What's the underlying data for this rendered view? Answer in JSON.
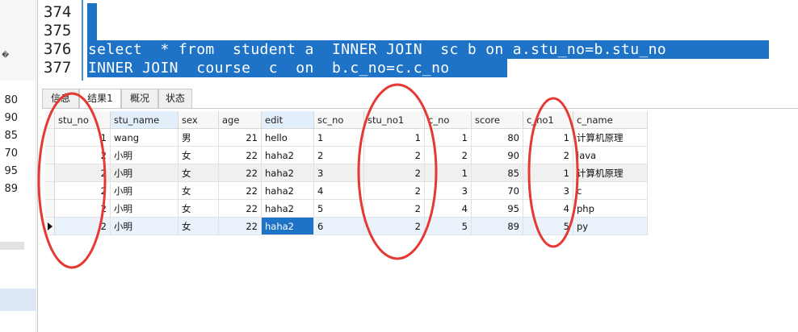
{
  "left_pane": {
    "mini_label": "�",
    "row_numbers": [
      "80",
      "90",
      "85",
      "70",
      "95",
      "89"
    ]
  },
  "editor": {
    "line_numbers": [
      "374",
      "375",
      "376",
      "377"
    ],
    "code_lines": [
      "select  * from  student a  INNER JOIN  sc b on a.stu_no=b.stu_no ",
      "INNER JOIN  course  c  on  b.c_no=c.c_no"
    ]
  },
  "tabs": [
    {
      "label": "信息"
    },
    {
      "label": "结果1"
    },
    {
      "label": "概况"
    },
    {
      "label": "状态"
    }
  ],
  "table": {
    "columns": [
      "stu_no",
      "stu_name",
      "sex",
      "age",
      "edit",
      "sc_no",
      "stu_no1",
      "c_no",
      "score",
      "c_no1",
      "c_name"
    ],
    "rows": [
      [
        "1",
        "wang",
        "男",
        "21",
        "hello",
        "1",
        "1",
        "1",
        "80",
        "1",
        "计算机原理"
      ],
      [
        "2",
        "小明",
        "女",
        "22",
        "haha2",
        "2",
        "2",
        "2",
        "90",
        "2",
        "java"
      ],
      [
        "2",
        "小明",
        "女",
        "22",
        "haha2",
        "3",
        "2",
        "1",
        "85",
        "1",
        "计算机原理"
      ],
      [
        "2",
        "小明",
        "女",
        "22",
        "haha2",
        "4",
        "2",
        "3",
        "70",
        "3",
        "c"
      ],
      [
        "2",
        "小明",
        "女",
        "22",
        "haha2",
        "5",
        "2",
        "4",
        "95",
        "4",
        "php"
      ],
      [
        "2",
        "小明",
        "女",
        "22",
        "haha2",
        "6",
        "2",
        "5",
        "89",
        "5",
        "py"
      ]
    ]
  },
  "colors": {
    "selection": "#1e73c7",
    "annotation_circle": "#e53935"
  }
}
